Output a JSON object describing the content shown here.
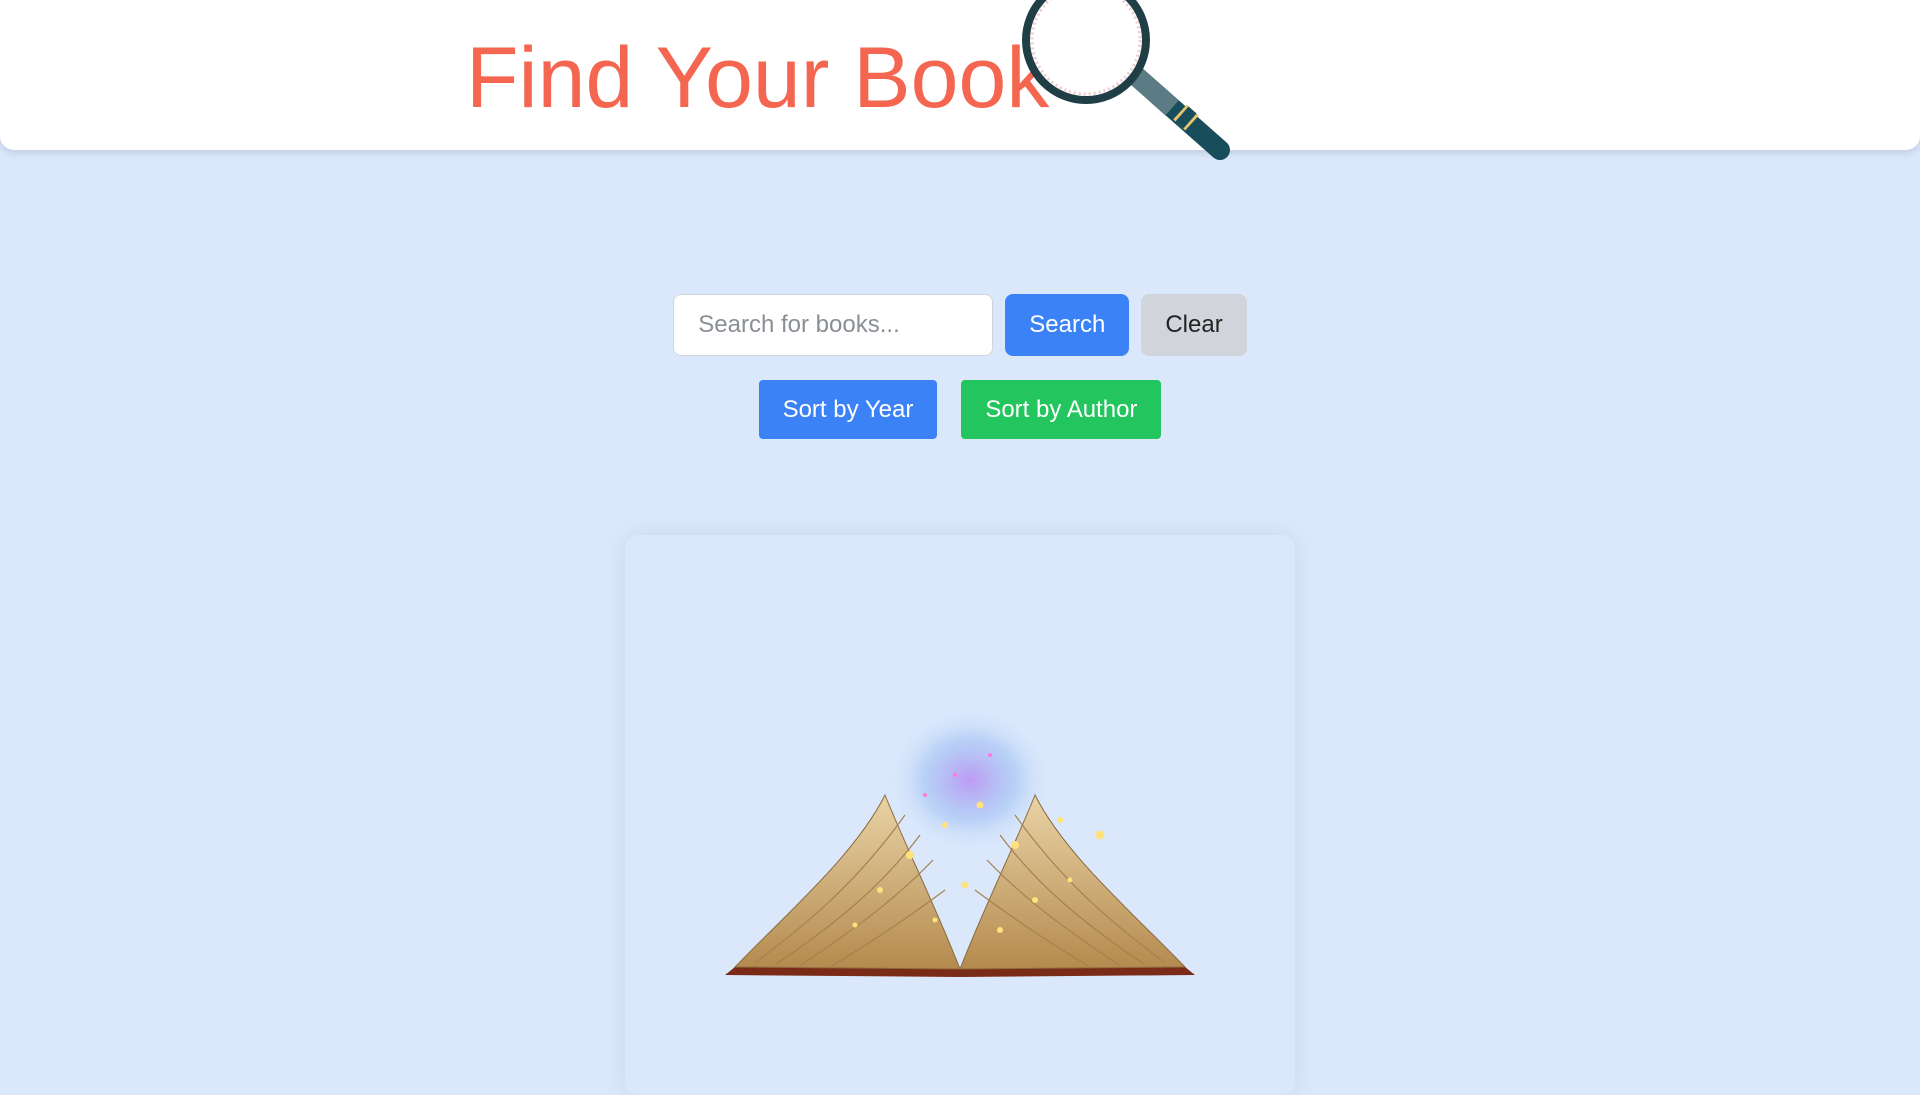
{
  "header": {
    "title": "Find Your Book"
  },
  "search": {
    "placeholder": "Search for books...",
    "value": "",
    "search_label": "Search",
    "clear_label": "Clear"
  },
  "sort": {
    "year_label": "Sort by Year",
    "author_label": "Sort by Author"
  },
  "icons": {
    "header_icon": "magnifying-glass-icon",
    "card_image": "open-book-illustration"
  },
  "colors": {
    "background": "#dbe8fc",
    "title": "#f4664f",
    "primary": "#3b82f6",
    "secondary": "#d1d5db",
    "success": "#22c55e"
  }
}
